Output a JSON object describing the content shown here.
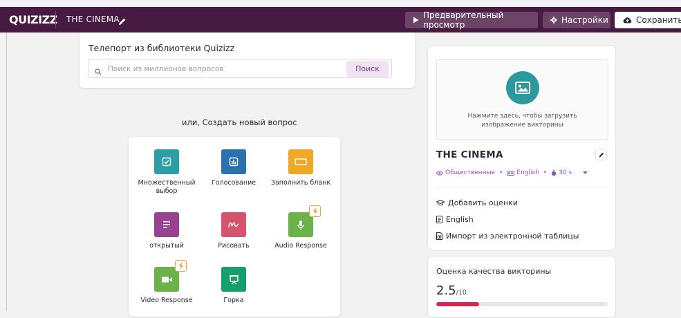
{
  "app": {
    "logo": "QUIZIZZ",
    "quiz_title": "THE CINEMA"
  },
  "topbar": {
    "preview_label": "Предварительный просмотр",
    "settings_label": "Настройки",
    "save_label": "Сохранить"
  },
  "teleport": {
    "title": "Телепорт из библиотеки Quizizz",
    "search_placeholder": "Поиск из миллионов вопросов",
    "search_button": "Поиск"
  },
  "create": {
    "heading": "или, Создать новый вопрос",
    "types": [
      {
        "label": "Множественный выбор",
        "icon": "checkbox-icon",
        "color": "#2d9da6"
      },
      {
        "label": "Голосование",
        "icon": "poll-chart-icon",
        "color": "#2d70ae"
      },
      {
        "label": "Заполнить бланк",
        "icon": "blank-field-icon",
        "color": "#efa929"
      },
      {
        "label": "открытый",
        "icon": "open-text-icon",
        "color": "#9a4292"
      },
      {
        "label": "Рисовать",
        "icon": "draw-scribble-icon",
        "color": "#d5546d"
      },
      {
        "label": "Audio Response",
        "icon": "microphone-icon",
        "color": "#6bb24b"
      },
      {
        "label": "Video Response",
        "icon": "video-camera-icon",
        "color": "#6bb24b"
      },
      {
        "label": "Горка",
        "icon": "presentation-slide-icon",
        "color": "#169e6d"
      }
    ]
  },
  "quiz_panel": {
    "upload_text": "Нажмите здесь, чтобы загрузить\nизображение викторины",
    "name": "THE CINEMA",
    "visibility": "Общественные",
    "language": "English",
    "timer": "30 s",
    "add_grades": "Добавить оценки",
    "language_option": "English",
    "import_sheet": "Импорт из электронной таблицы"
  },
  "quality": {
    "title": "Оценка качества викторины",
    "score": "2.5",
    "max": "/10",
    "score_value": 2.5,
    "max_value": 10,
    "bar_color": "#e0234e"
  }
}
